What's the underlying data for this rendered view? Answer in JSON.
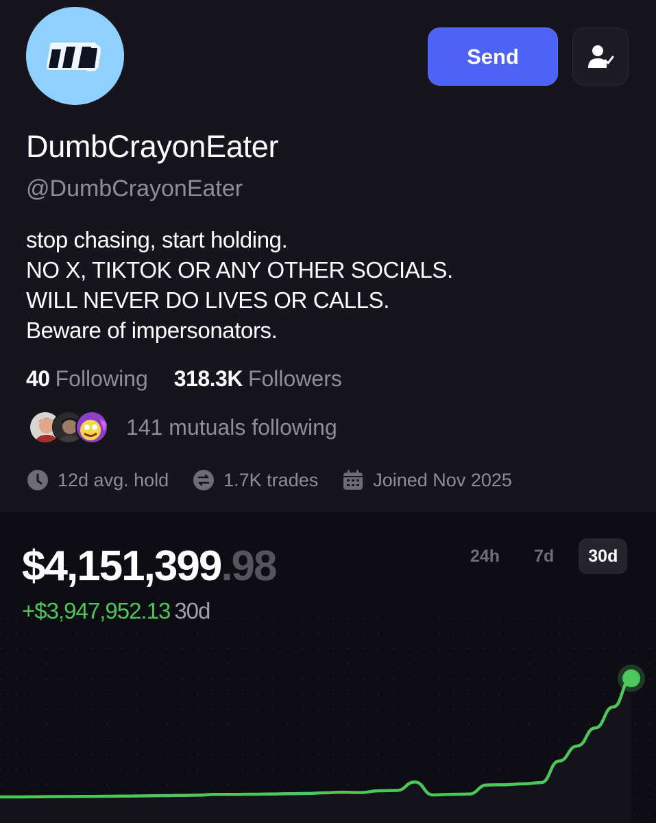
{
  "profile": {
    "display_name": "DumbCrayonEater",
    "handle": "@DumbCrayonEater",
    "bio_lines": [
      "stop chasing, start holding.",
      "NO X, TIKTOK OR ANY OTHER SOCIALS.",
      "WILL NEVER DO LIVES OR CALLS.",
      "Beware of impersonators."
    ],
    "avatar_icon": "double-quote-logo-icon",
    "avatar_color": "#8fd0ff"
  },
  "actions": {
    "send_label": "Send",
    "follow_icon": "user-check-icon",
    "send_color": "#4c63f5"
  },
  "stats": {
    "following_count": "40",
    "following_label": "Following",
    "followers_count": "318.3K",
    "followers_label": "Followers"
  },
  "mutuals": {
    "text": "141 mutuals following"
  },
  "meta": {
    "avg_hold": "12d avg. hold",
    "trades": "1.7K trades",
    "joined": "Joined Nov 2025",
    "icons": [
      "clock-icon",
      "swap-icon",
      "calendar-icon"
    ]
  },
  "portfolio": {
    "balance_whole": "$4,151,399",
    "balance_cents": ".98",
    "gain_amount": "+$3,947,952.13",
    "gain_period": "30d",
    "gain_color": "#4cc75a",
    "ranges": [
      "24h",
      "7d",
      "30d"
    ],
    "active_range": "30d"
  },
  "chart_data": {
    "type": "line",
    "title": "",
    "xlabel": "",
    "ylabel": "",
    "series": [
      {
        "values": [
          203617,
          203617,
          210000,
          215000,
          218000,
          222000,
          226000,
          232000,
          238000,
          246000,
          254000,
          262000,
          290000,
          288000,
          296000,
          300000,
          310000,
          320000,
          340000,
          360000,
          350000,
          410000,
          420000,
          700000,
          270000,
          290000,
          300000,
          600000,
          610000,
          640000,
          680000,
          1400000,
          1900000,
          2500000,
          3200000,
          4151400
        ]
      }
    ],
    "line_color": "#4cc75a",
    "end_marker": true,
    "grid": "dotted"
  }
}
